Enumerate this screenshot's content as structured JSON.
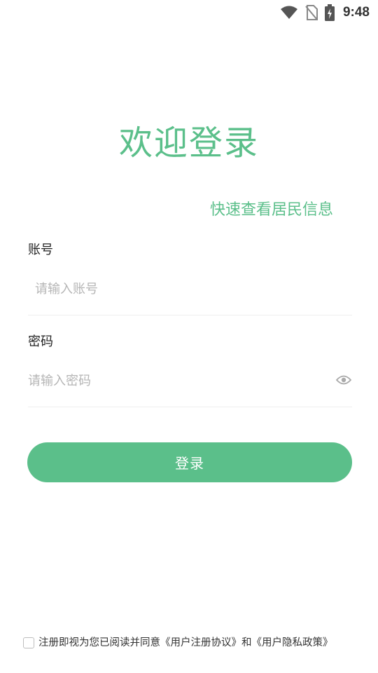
{
  "status_bar": {
    "time": "9:48",
    "icons": [
      "wifi-icon",
      "no-sim-icon",
      "battery-charging-icon"
    ]
  },
  "header": {
    "title": "欢迎登录",
    "subtitle": "快速查看居民信息"
  },
  "form": {
    "account": {
      "label": "账号",
      "placeholder": "请输入账号",
      "value": ""
    },
    "password": {
      "label": "密码",
      "placeholder": "请输入密码",
      "value": "",
      "toggle_icon": "eye-icon"
    },
    "submit_label": "登录"
  },
  "agreement": {
    "checked": false,
    "text": "注册即视为您已阅读并同意《用户注册协议》和《用户隐私政策》"
  },
  "colors": {
    "accent": "#5bbf8a",
    "placeholder": "#b5b5b5",
    "divider": "#eeeeee"
  }
}
